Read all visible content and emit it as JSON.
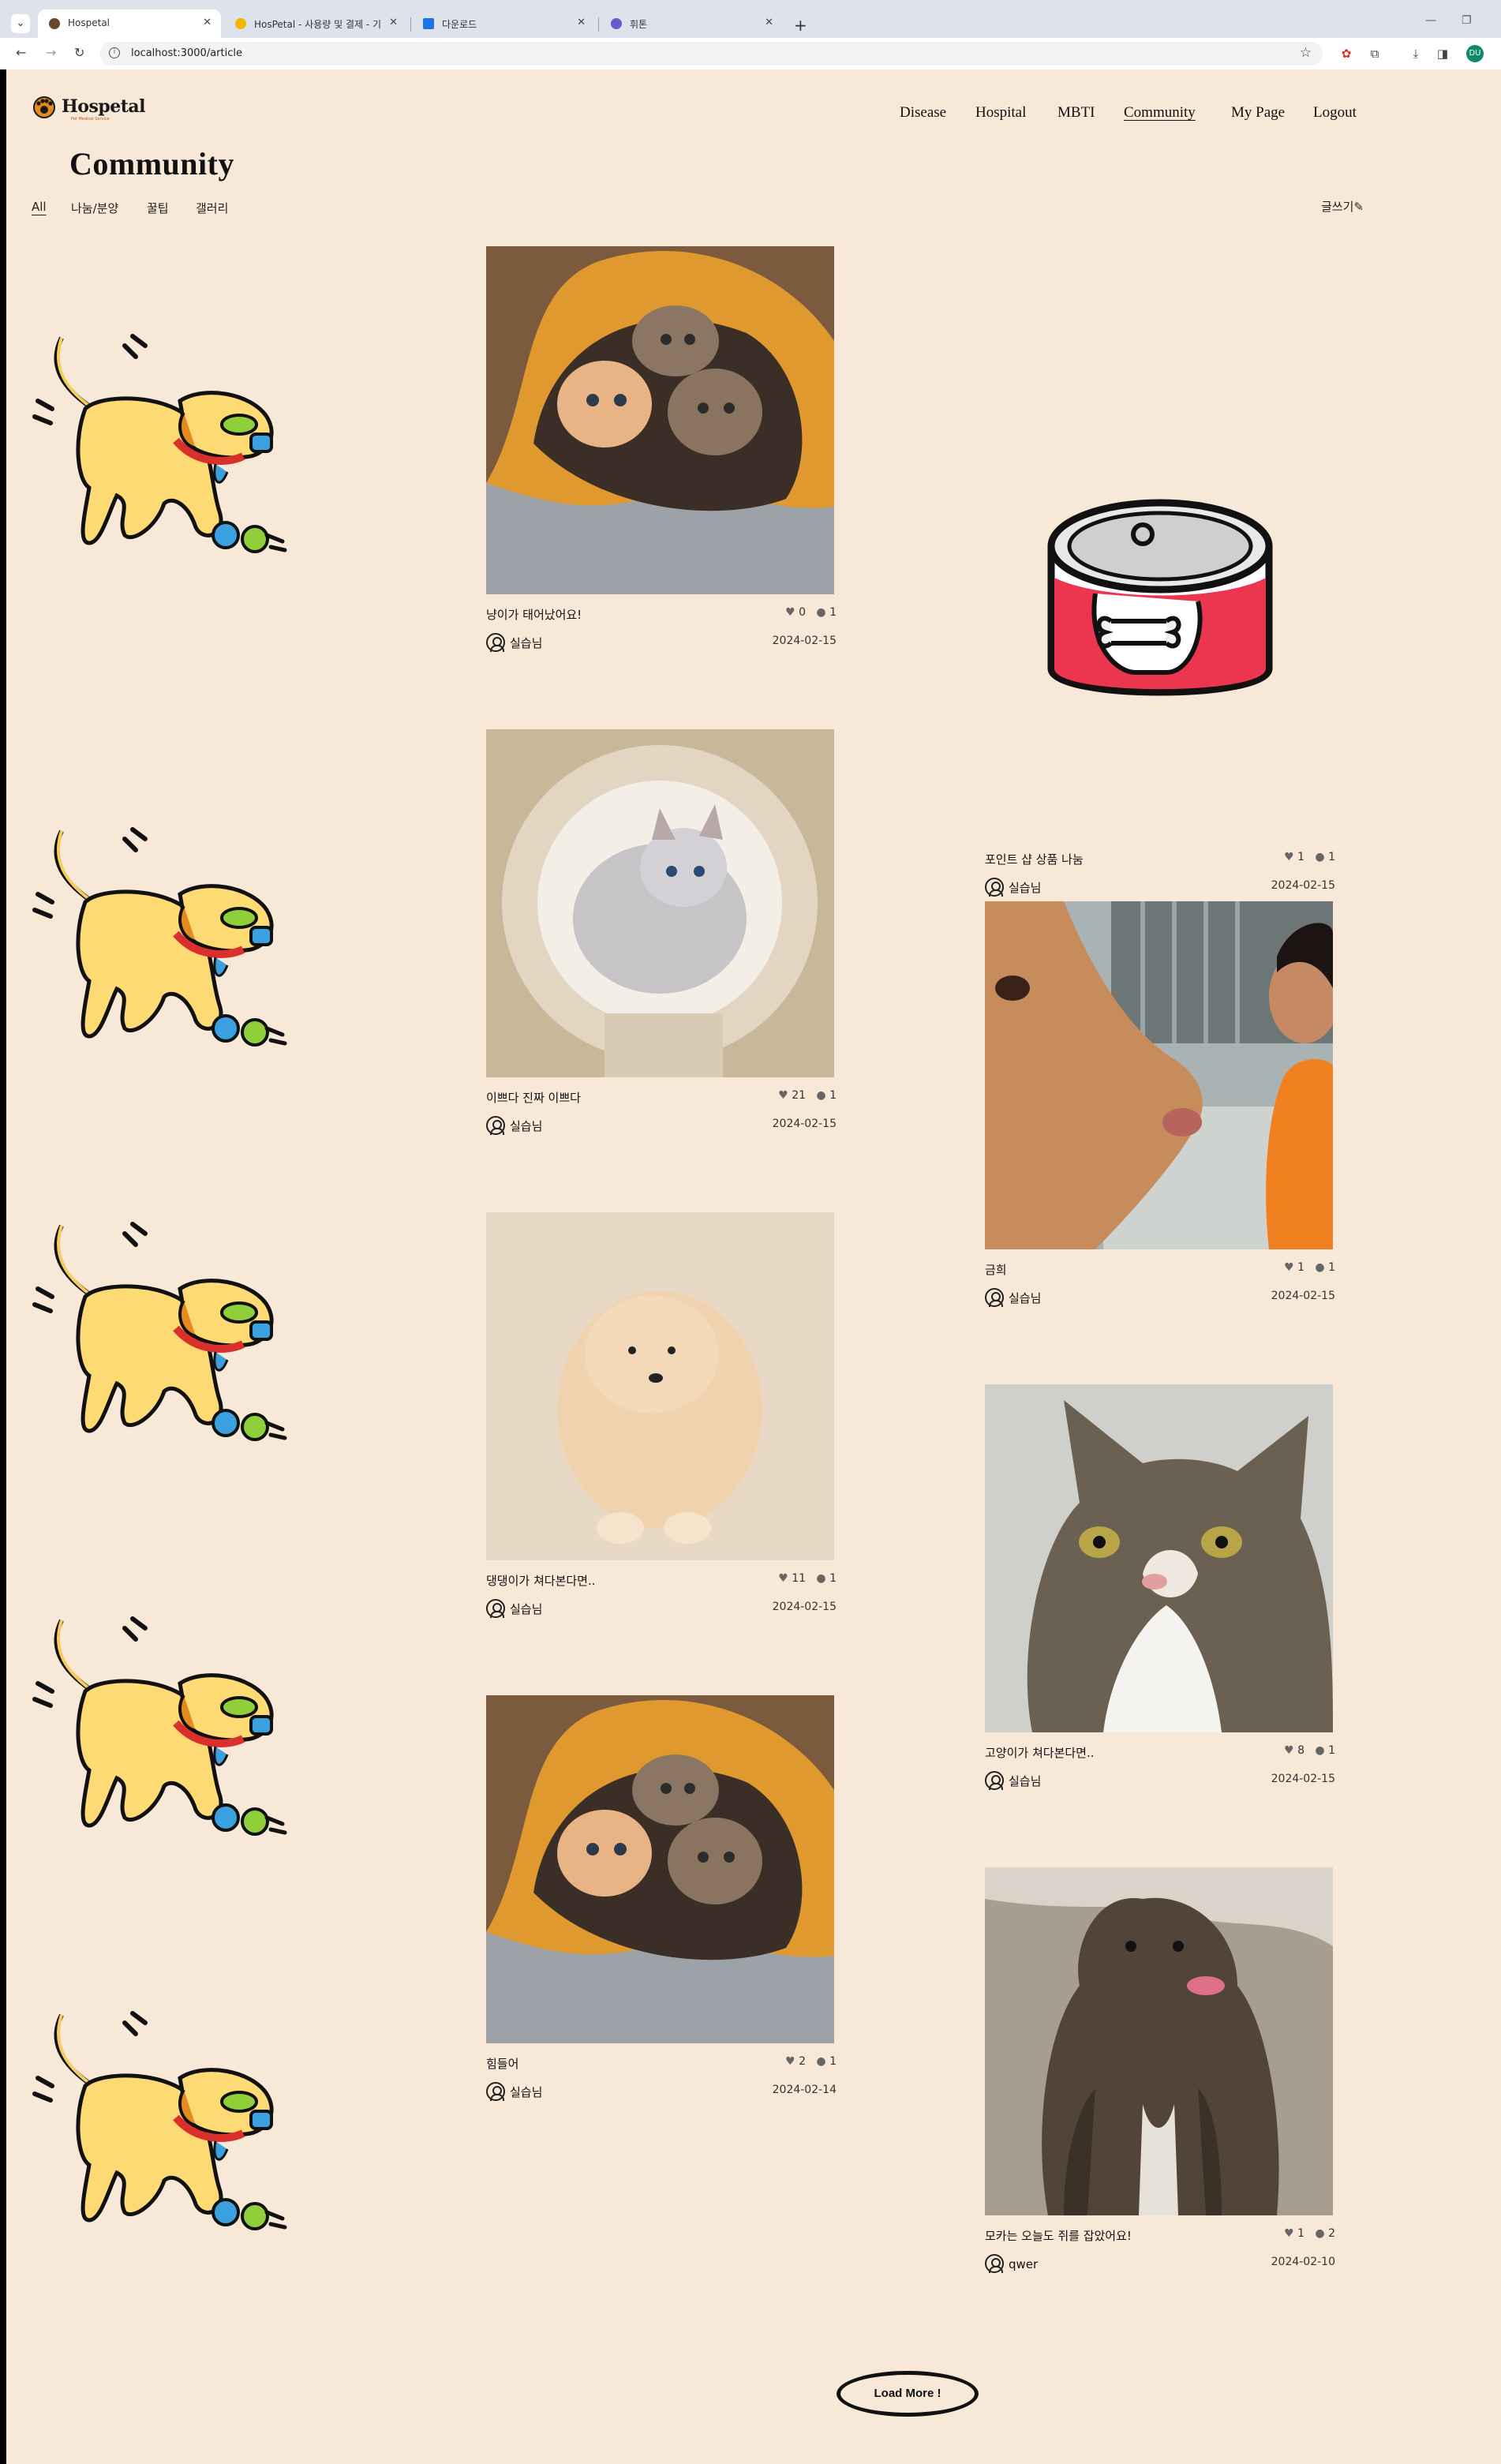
{
  "browser": {
    "tabs": [
      {
        "title": "Hospetal",
        "active": true
      },
      {
        "title": "HosPetal - 사용량 및 결제 - 기"
      },
      {
        "title": "다운로드"
      },
      {
        "title": "휘톤"
      }
    ],
    "url": "localhost:3000/article",
    "profile_initial": "DU"
  },
  "header": {
    "logo_text": "Hospetal",
    "logo_subtitle": "Pet Medical Service",
    "nav": [
      {
        "label": "Disease"
      },
      {
        "label": "Hospital"
      },
      {
        "label": "MBTI"
      },
      {
        "label": "Community",
        "current": true
      },
      {
        "label": "My Page"
      },
      {
        "label": "Logout"
      }
    ]
  },
  "page": {
    "title": "Community",
    "categories": [
      {
        "label": "All",
        "current": true
      },
      {
        "label": "나눔/분양"
      },
      {
        "label": "꿀팁"
      },
      {
        "label": "갤러리"
      }
    ],
    "write_label": "글쓰기"
  },
  "posts": [
    {
      "title": "냥이가 태어났어요!",
      "likes": "0",
      "comments": "1",
      "author": "실습님",
      "date": "2024-02-15",
      "image": "kittens-blanket"
    },
    {
      "title": "포인트 샵 상품 나눔",
      "likes": "1",
      "comments": "1",
      "author": "실습님",
      "date": "2024-02-15",
      "image": "pet-food-can"
    },
    {
      "title": "이쁘다 진짜 이쁘다",
      "likes": "21",
      "comments": "1",
      "author": "실습님",
      "date": "2024-02-15",
      "image": "kitten-tunnel"
    },
    {
      "title": "금희",
      "likes": "1",
      "comments": "1",
      "author": "실습님",
      "date": "2024-02-15",
      "image": "cow-selfie"
    },
    {
      "title": "댕댕이가 쳐다본다면..",
      "likes": "11",
      "comments": "1",
      "author": "실습님",
      "date": "2024-02-15",
      "image": "fluffy-puppy"
    },
    {
      "title": "고양이가 쳐다본다면..",
      "likes": "8",
      "comments": "1",
      "author": "실습님",
      "date": "2024-02-15",
      "image": "tabby-cat"
    },
    {
      "title": "힘들어",
      "likes": "2",
      "comments": "1",
      "author": "실습님",
      "date": "2024-02-14",
      "image": "kittens-blanket"
    },
    {
      "title": "모카는 오늘도 쥐를 잡았어요!",
      "likes": "1",
      "comments": "2",
      "author": "qwer",
      "date": "2024-02-10",
      "image": "brindle-dog"
    }
  ],
  "load_more_label": "Load More !",
  "colors": {
    "page_bg": "#f7e8d7",
    "chrome_bg": "#dee3eb"
  }
}
